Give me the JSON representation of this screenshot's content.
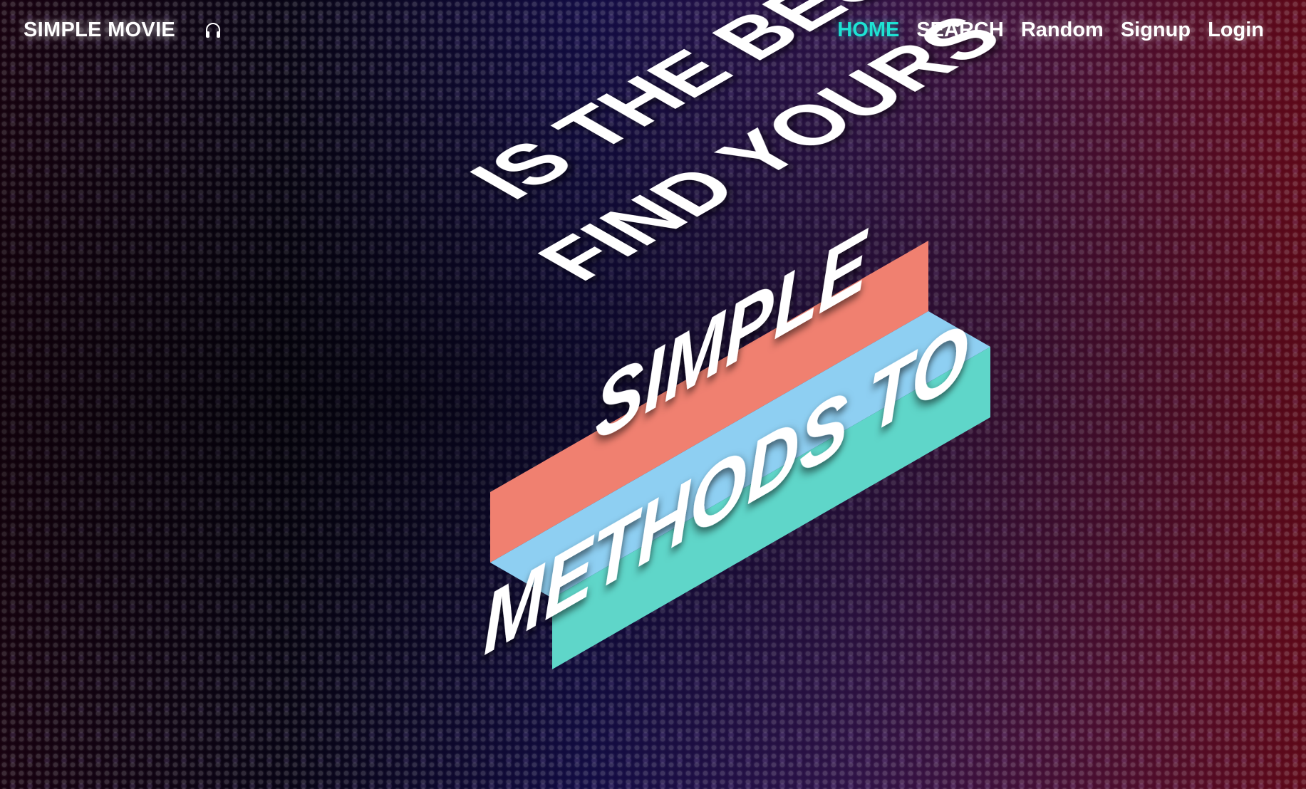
{
  "brand": {
    "title": "SIMPLE MOVIE",
    "icon": "headphone-icon"
  },
  "nav": {
    "items": [
      {
        "label": "HOME",
        "active": true
      },
      {
        "label": "SEARCH",
        "active": false
      },
      {
        "label": "Random",
        "active": false
      },
      {
        "label": "Signup",
        "active": false
      },
      {
        "label": "Login",
        "active": false
      }
    ],
    "active_color": "#1ee3d3"
  },
  "hero": {
    "lines": [
      "SIMPLE",
      "IS THE BEST",
      "METHODS TO",
      "FIND YOURS"
    ],
    "colors": {
      "band_1": "#f08070",
      "band_2": "#8ecff2",
      "band_3": "#5fd6c9"
    }
  }
}
